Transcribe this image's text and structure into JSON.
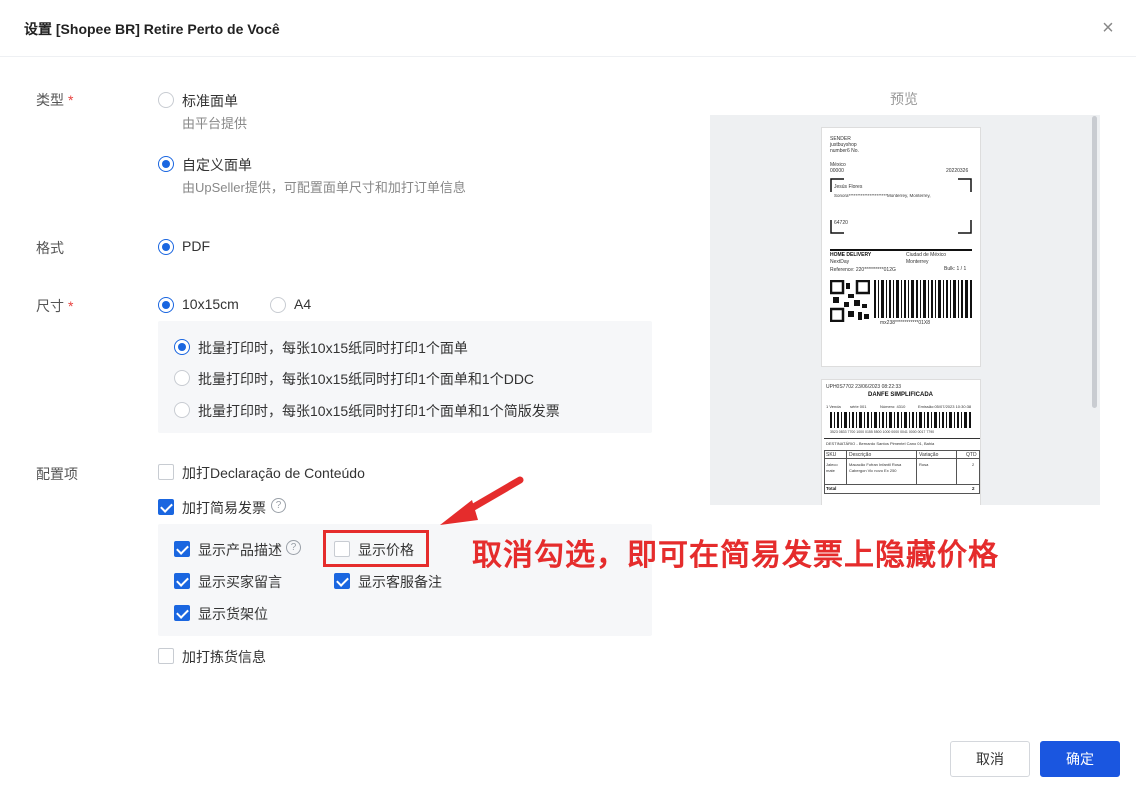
{
  "dialog": {
    "title": "设置 [Shopee BR] Retire Perto de Você",
    "close_glyph": "×"
  },
  "type_section": {
    "label": "类型",
    "required_mark": "*",
    "options": [
      {
        "label": "标准面单",
        "desc": "由平台提供",
        "selected": false
      },
      {
        "label": "自定义面单",
        "desc": "由UpSeller提供，可配置面单尺寸和加打订单信息",
        "selected": true
      }
    ]
  },
  "format_section": {
    "label": "格式",
    "options": [
      {
        "label": "PDF",
        "selected": true
      }
    ]
  },
  "size_section": {
    "label": "尺寸",
    "required_mark": "*",
    "options": [
      {
        "label": "10x15cm",
        "selected": true
      },
      {
        "label": "A4",
        "selected": false
      }
    ],
    "batch_options": [
      {
        "label": "批量打印时，每张10x15纸同时打印1个面单",
        "selected": true
      },
      {
        "label": "批量打印时，每张10x15纸同时打印1个面单和1个DDC",
        "selected": false
      },
      {
        "label": "批量打印时，每张10x15纸同时打印1个面单和1个简版发票",
        "selected": false
      }
    ]
  },
  "config_section": {
    "label": "配置项",
    "items": [
      {
        "label": "加打Declaração de Conteúdo",
        "checked": false
      },
      {
        "label": "加打简易发票",
        "checked": true,
        "help": "?"
      },
      {
        "label": "加打拣货信息",
        "checked": false
      }
    ],
    "invoice_options": {
      "show_desc": {
        "label": "显示产品描述",
        "checked": true,
        "help": "?"
      },
      "show_price": {
        "label": "显示价格",
        "checked": false
      },
      "show_buyer_note": {
        "label": "显示买家留言",
        "checked": true
      },
      "show_service_note": {
        "label": "显示客服备注",
        "checked": true
      },
      "show_shelf": {
        "label": "显示货架位",
        "checked": true
      }
    }
  },
  "annotation": {
    "text": "取消勾选，即可在简易发票上隐藏价格",
    "color": "#e52c2c"
  },
  "preview": {
    "title": "预览",
    "label1": {
      "sender_label": "SENDER",
      "sender_name": "justbuyshop",
      "sender_num": "number6 No.",
      "sender_city": "México",
      "sender_zip": "00000",
      "date": "20220326",
      "recipient_name": "Jesús Flores",
      "recipient_addr": "Sonora**********************Monterrey, Monterrey,",
      "recipient_zip": "64720",
      "service": "HOME DELIVERY",
      "city": "Ciudad de México",
      "carrier": "NextDay",
      "dest_city": "Monterrey",
      "reference": "Reference: 220**********012G",
      "bulk": "Bulk: 1 / 1",
      "tracking": "mx238************01X8"
    },
    "label2": {
      "header": "UPH0S7702   23/06/2023 08:22:33",
      "title": "DANFE SIMPLIFICADA",
      "info1": "1 Venda",
      "info2": "série 001",
      "info3": "Número: 4310",
      "info4": "Emissão:05/07/2023 10:30:38",
      "barcode_num": "3523 0833 7700 1000 0155 5500 1000 0000 0041 0000 0017 7790",
      "destination": "DESTINATÁRIO - Bernardo Santos Pimentel Cano 01, Bahia",
      "col_sku": "SKU",
      "col_desc": "Descrição",
      "col_var": "Variação",
      "col_qty": "QTD",
      "row_sku": "Jaleco mate",
      "row_desc": "Macacão Fofran Infantil Rosa Cabergon Vic novo Ex 250",
      "row_var": "Rosa",
      "row_qty": "2",
      "total_label": "Total",
      "total_val": "2"
    }
  },
  "footer": {
    "cancel_label": "取消",
    "ok_label": "确定"
  }
}
